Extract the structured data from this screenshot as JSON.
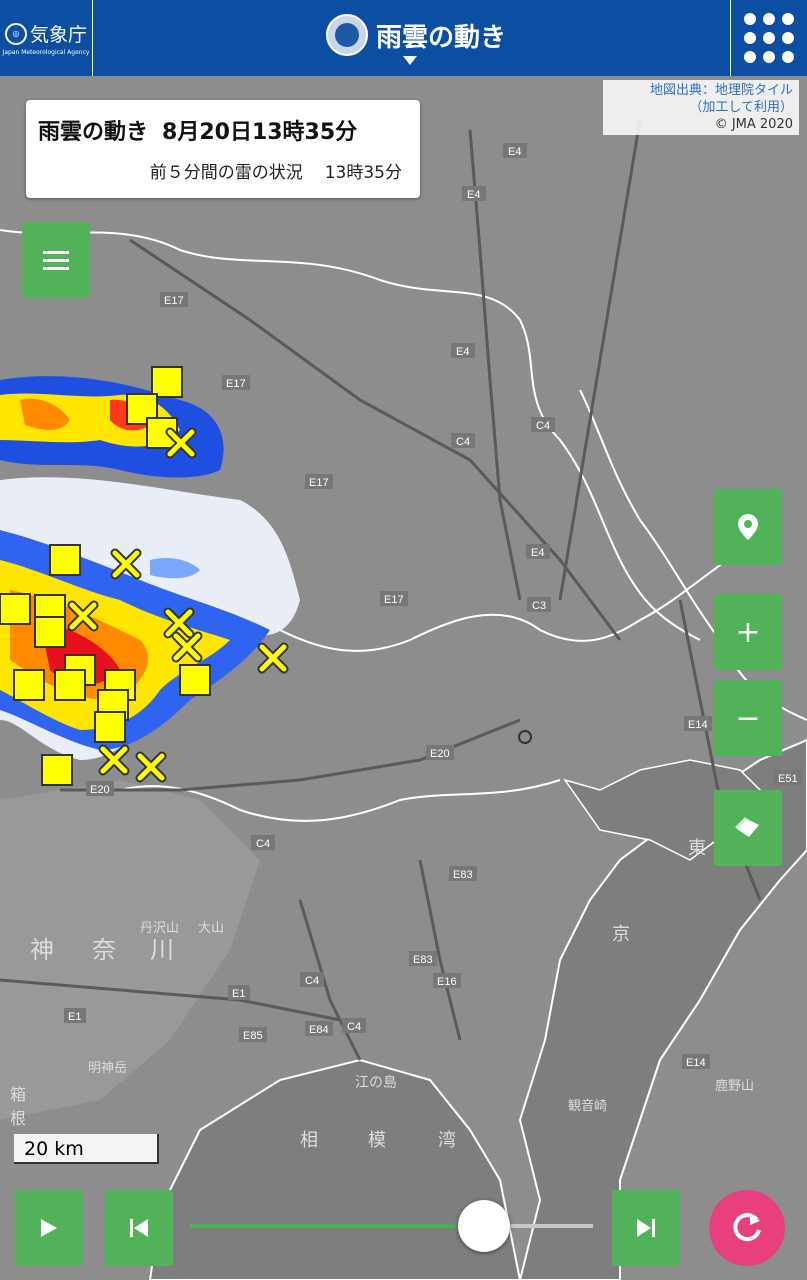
{
  "header": {
    "logo_text": "気象庁",
    "logo_sub": "Japan Meteorological Agency",
    "title": "雨雲の動き"
  },
  "map_credit": {
    "line1": "地図出典：地理院タイル",
    "line2": "（加工して利用）",
    "line3": "© JMA 2020"
  },
  "info_box": {
    "title": "雨雲の動き",
    "datetime": "8月20日13時35分",
    "subtitle": "前５分間の雷の状況",
    "sub_time": "13時35分"
  },
  "map_labels": {
    "expressways": [
      "E4",
      "E4",
      "E17",
      "E17",
      "E4",
      "C4",
      "C4",
      "E17",
      "E4",
      "C3",
      "E17",
      "E20",
      "E20",
      "C4",
      "E83",
      "E83",
      "E16",
      "E1",
      "E85",
      "E84",
      "C4",
      "C4",
      "E1",
      "E14",
      "E14",
      "E51"
    ],
    "places": [
      "神",
      "奈",
      "川",
      "丹沢山",
      "大山",
      "江の島",
      "相",
      "模",
      "湾",
      "東",
      "京",
      "観音崎",
      "鹿野山",
      "明神岳",
      "箱",
      "根"
    ]
  },
  "scale": {
    "label": "20 km"
  },
  "controls": {
    "location_icon": "map-pin-icon",
    "zoom_in": "+",
    "zoom_out": "−",
    "layers_icon": "layers-icon",
    "menu_icon": "hamburger-icon"
  },
  "playback": {
    "play_icon": "play-icon",
    "prev_icon": "step-back-icon",
    "next_icon": "step-forward-icon",
    "refresh_icon": "refresh-icon",
    "progress": 0.73
  },
  "colors": {
    "header_bg": "#0b4ea2",
    "button_green": "#4caf50",
    "refresh_pink": "#e8407e",
    "lightning_yellow": "#ffff00"
  }
}
